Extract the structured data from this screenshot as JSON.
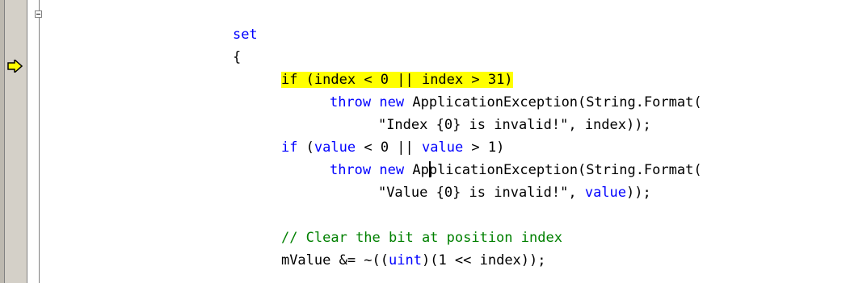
{
  "editor": {
    "gutter": {
      "arrow_icon": "current-statement-arrow-icon",
      "arrow_color": "#ffff00",
      "collapse_icon": "collapse-minus-icon"
    },
    "colors": {
      "keyword": "#0000ff",
      "comment": "#008000",
      "highlight": "#ffff00"
    },
    "lines": [
      {
        "kw1": "set"
      },
      {
        "text": "{"
      },
      {
        "kw1": "if",
        "rest": " (index < 0 || index > 31)"
      },
      {
        "kw1": "throw",
        "kw2": "new",
        "rest": " ApplicationException(String.Format("
      },
      {
        "text": "\"Index {0} is invalid!\", index));"
      },
      {
        "kw1": "if",
        "mid1": " (",
        "kw2": "value",
        "mid2": " < 0 || ",
        "kw3": "value",
        "rest": " > 1)"
      },
      {
        "kw1": "throw",
        "kw2": "new",
        "pre_caret": " Ap",
        "post_caret": "plicationException(String.Format("
      },
      {
        "text1": "\"Value {0} is invalid!\", ",
        "kw1": "value",
        "text2": "));"
      },
      {
        "comment": "// Clear the bit at position index"
      },
      {
        "text1": "mValue &= ~((",
        "kw1": "uint",
        "text2": ")(1 << index));"
      }
    ]
  }
}
